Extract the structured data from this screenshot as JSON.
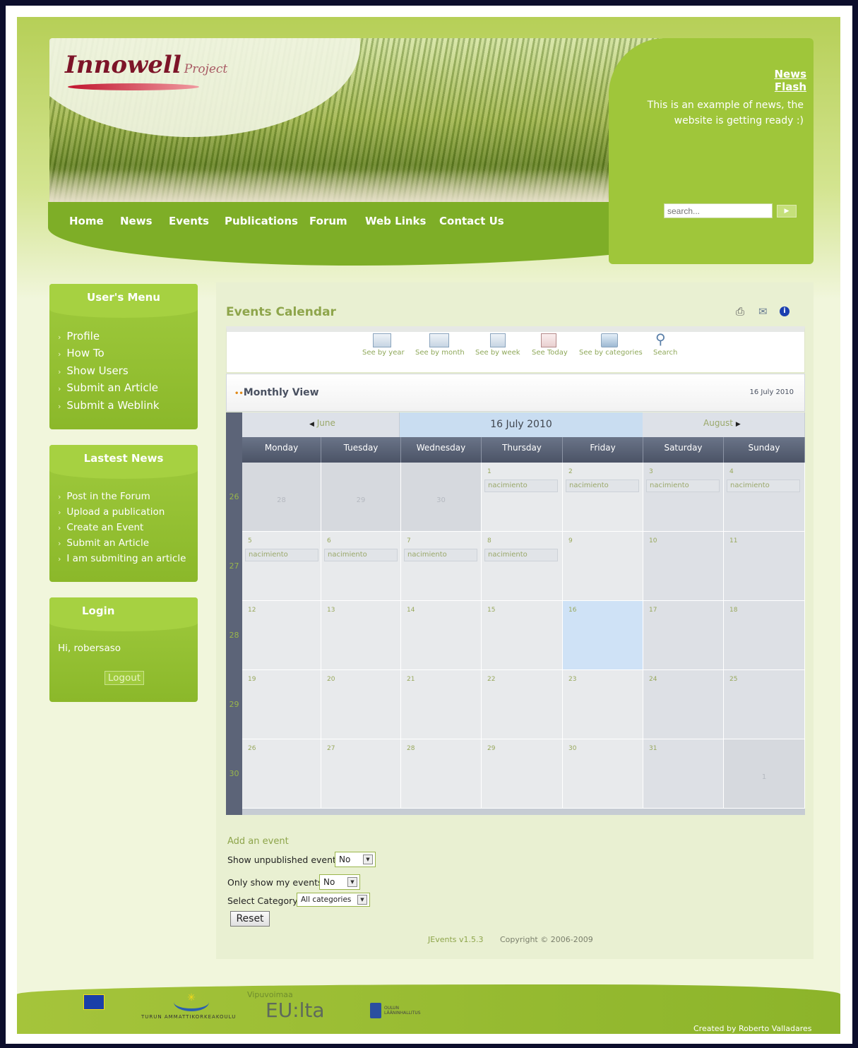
{
  "header": {
    "logo_text": "Innowell",
    "logo_sub": "Project",
    "news_flash_title": "News Flash",
    "news_flash_text": "This is an example of news, the website is getting ready :)",
    "search_placeholder": "search..."
  },
  "nav": [
    "Home",
    "News",
    "Events",
    "Publications",
    "Forum",
    "Web Links",
    "Contact Us"
  ],
  "user_menu": {
    "title": "User's Menu",
    "items": [
      "Profile",
      "How To",
      "Show Users",
      "Submit an Article",
      "Submit a Weblink"
    ]
  },
  "latest_news": {
    "title": "Lastest News",
    "items": [
      "Post in the Forum",
      "Upload a publication",
      "Create an Event",
      "Submit an Article",
      "I am submiting an article"
    ]
  },
  "login": {
    "title": "Login",
    "greeting": "Hi, robersaso",
    "logout_label": "Logout"
  },
  "events": {
    "title": "Events Calendar",
    "toolbar": [
      "See by year",
      "See by month",
      "See by week",
      "See Today",
      "See by categories",
      "Search"
    ],
    "view_label": "Monthly View",
    "view_date": "16 July 2010",
    "prev_month": "June",
    "current": "16 July 2010",
    "next_month": "August",
    "weekdays": [
      "Monday",
      "Tuesday",
      "Wednesday",
      "Thursday",
      "Friday",
      "Saturday",
      "Sunday"
    ],
    "event_name": "nacimiento",
    "weeks": [
      {
        "num": "26",
        "days": [
          "28",
          "29",
          "30",
          "1",
          "2",
          "3",
          "4"
        ]
      },
      {
        "num": "27",
        "days": [
          "5",
          "6",
          "7",
          "8",
          "9",
          "10",
          "11"
        ]
      },
      {
        "num": "28",
        "days": [
          "12",
          "13",
          "14",
          "15",
          "16",
          "17",
          "18"
        ]
      },
      {
        "num": "29",
        "days": [
          "19",
          "20",
          "21",
          "22",
          "23",
          "24",
          "25"
        ]
      },
      {
        "num": "30",
        "days": [
          "26",
          "27",
          "28",
          "29",
          "30",
          "31",
          "1"
        ]
      }
    ],
    "add_event": "Add an event",
    "show_unpublished_label": "Show unpublished events?",
    "show_unpublished_value": "No",
    "only_mine_label": "Only show my events?",
    "only_mine_value": "No",
    "category_label": "Select Category",
    "category_value": "All categories",
    "reset_label": "Reset",
    "jevents": "JEvents v1.5.3",
    "copyright": "Copyright © 2006-2009"
  },
  "footer": {
    "credit": "Created by Roberto Valladares",
    "eu_text": "EU:lta",
    "eu_above": "Vipuvoimaa",
    "logo2_text": "TURUN AMMATTIKORKEAKOULU",
    "logo3_text": "OULUN LÄÄNINHALLITUS"
  },
  "colors": {
    "accent": "#8cb82a",
    "nav": "#85b72c",
    "calendar_header": "#5c6478",
    "today": "#cfe2f6"
  }
}
